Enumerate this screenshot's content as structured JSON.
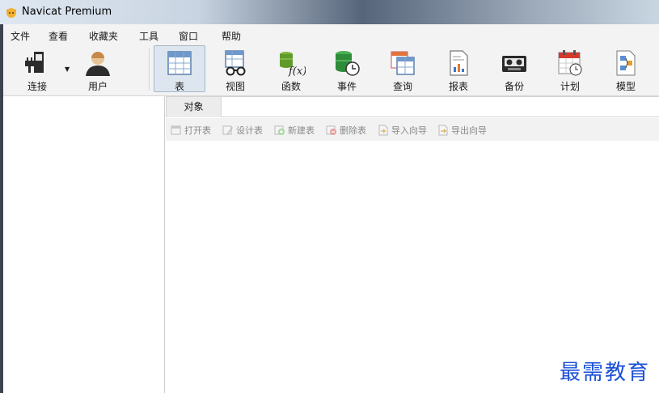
{
  "window": {
    "title": "Navicat Premium"
  },
  "menu": [
    "文件",
    "查看",
    "收藏夹",
    "工具",
    "窗口",
    "帮助"
  ],
  "toolbar": {
    "connect": "连接",
    "user": "用户",
    "table": "表",
    "view": "视图",
    "function": "函数",
    "event": "事件",
    "query": "查询",
    "report": "报表",
    "backup": "备份",
    "schedule": "计划",
    "model": "模型"
  },
  "tabs": {
    "object": "对象"
  },
  "object_toolbar": {
    "open": "打开表",
    "design": "设计表",
    "new": "新建表",
    "delete": "删除表",
    "import": "导入向导",
    "export": "导出向导"
  },
  "watermark": "最需教育",
  "colors": {
    "accent_green": "#3a9a3a",
    "watermark": "#1a4fd8",
    "active_tool_bg": "#dde6ef"
  }
}
